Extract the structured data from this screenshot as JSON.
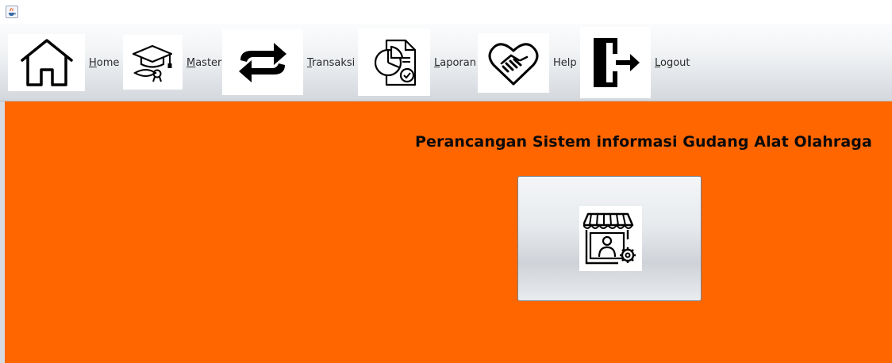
{
  "menu": {
    "home": {
      "label_mnemonic": "H",
      "label_rest": "ome",
      "icon": "home-icon"
    },
    "master": {
      "label_mnemonic": "M",
      "label_rest": "aster",
      "icon": "graduation-cap-icon"
    },
    "transaksi": {
      "label_mnemonic": "T",
      "label_rest": "ransaksi",
      "icon": "exchange-arrows-icon"
    },
    "laporan": {
      "label_mnemonic": "L",
      "label_rest": "aporan",
      "icon": "report-chart-icon"
    },
    "help": {
      "label_mnemonic": "",
      "label_rest": "Help",
      "icon": "handshake-heart-icon"
    },
    "logout": {
      "label_mnemonic": "L",
      "label_rest": "ogout",
      "icon": "logout-door-icon"
    }
  },
  "main": {
    "title": "Perancangan Sistem informasi Gudang Alat Olahraga",
    "button_icon": "store-admin-icon"
  },
  "colors": {
    "background": "#ff6600",
    "menubar": "#e6e9ec"
  }
}
